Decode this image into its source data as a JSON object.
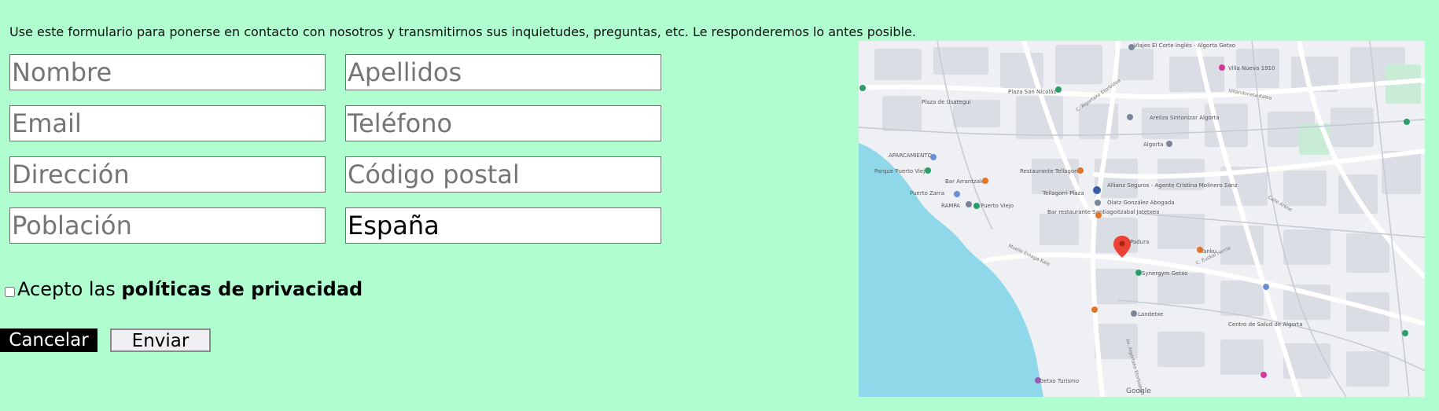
{
  "intro_text": "Use este formulario para ponerse en contacto con nosotros y transmitirnos sus inquietudes, preguntas, etc. Le responderemos lo antes posible.",
  "form": {
    "nombre": {
      "placeholder": "Nombre",
      "value": ""
    },
    "apellidos": {
      "placeholder": "Apellidos",
      "value": ""
    },
    "email": {
      "placeholder": "Email",
      "value": ""
    },
    "telefono": {
      "placeholder": "Teléfono",
      "value": ""
    },
    "direccion": {
      "placeholder": "Dirección",
      "value": ""
    },
    "codigo_postal": {
      "placeholder": "Código postal",
      "value": ""
    },
    "poblacion": {
      "placeholder": "Población",
      "value": ""
    },
    "pais": {
      "placeholder": "",
      "value": "España"
    }
  },
  "consent": {
    "prefix": "Acepto las ",
    "link": "políticas de privacidad",
    "checked": false
  },
  "buttons": {
    "cancel": "Cancelar",
    "send": "Enviar"
  },
  "map": {
    "pin_label": "Padura",
    "places": [
      "Viajes El Corte Inglés - Algorta Getxo",
      "Villa Nueva 1910",
      "Plaza San Nicolás",
      "Plaza de Usategui",
      "Areliza Sintonizar Algorta",
      "Algorta",
      "APARCAMIENTO",
      "Parque Puerto Viejo",
      "Restaurante Tellagorri",
      "Allianz Seguros - Agente Cristina Molinero Sanz",
      "Bar Arrantzale",
      "Puerto Viejo",
      "Tellagorri Plaza",
      "Olatz González Abogada",
      "Bar restaurante Santiagoitzabal Jatetxea",
      "Tanku",
      "Synergym Getxo",
      "Landetxe",
      "Centro de Salud de Algorta",
      "Getxo Turismo",
      "Puerto Zarra",
      "RAMPA"
    ],
    "streets": [
      "Muelle Ereaga Kaia",
      "Calle Arene",
      "C. Euskal Herria",
      "Villandoneta Kalea",
      "C. Algortako Etorbidea",
      "Av. Algortako Etorbidea"
    ],
    "attribution": "Google",
    "colors": {
      "water": "#8fd8ea",
      "land": "#eef0f3",
      "road": "#ffffff",
      "block": "#d9dce2",
      "park": "#c8ecd6",
      "pin": "#ea4335"
    }
  }
}
